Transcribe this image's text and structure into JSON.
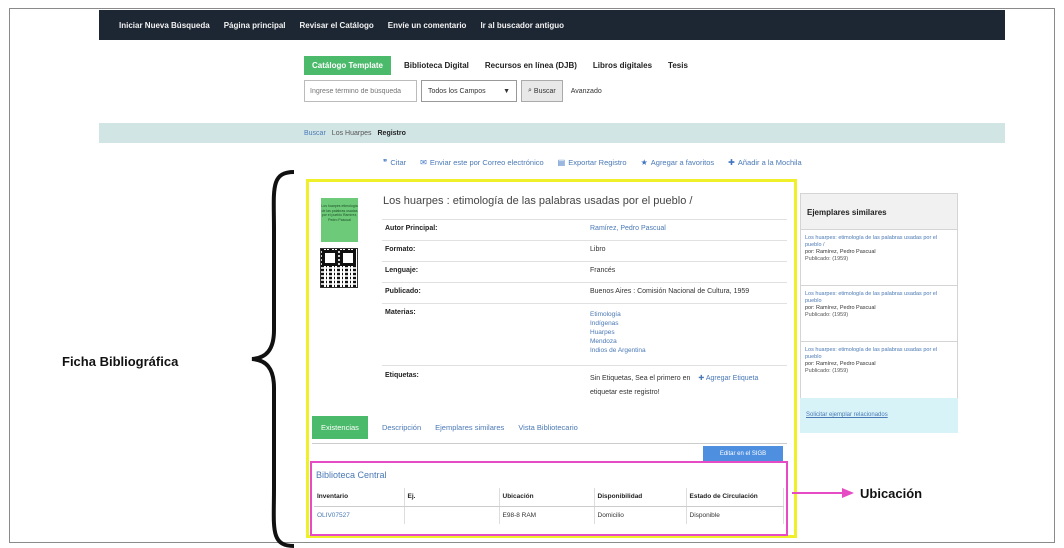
{
  "nav": {
    "items": [
      "Iniciar Nueva Búsqueda",
      "Página principal",
      "Revisar el Catálogo",
      "Envíe un comentario",
      "Ir al buscador antiguo"
    ]
  },
  "catalog_tabs": {
    "items": [
      "Catálogo Template",
      "Biblioteca Digital",
      "Recursos en línea (DJB)",
      "Libros digitales",
      "Tesis"
    ],
    "active_index": 0
  },
  "search": {
    "placeholder": "Ingrese término de búsqueda",
    "field_select": "Todos los Campos",
    "search_button": "Buscar",
    "advanced_link": "Avanzado"
  },
  "breadcrumb": {
    "items": [
      "Buscar",
      "Los Huarpes",
      "Registro"
    ]
  },
  "actions": {
    "items": [
      {
        "icon": "quote-icon",
        "label": "Citar"
      },
      {
        "icon": "mail-icon",
        "label": "Enviar este por Correo electrónico"
      },
      {
        "icon": "export-icon",
        "label": "Exportar Registro"
      },
      {
        "icon": "star-icon",
        "label": "Agregar a favoritos"
      },
      {
        "icon": "plus-icon",
        "label": "Añadir a la Mochila"
      }
    ]
  },
  "record": {
    "title": "Los huarpes : etimología de las palabras usadas por el pueblo /",
    "cover_text": "Los huarpes etimología de las palabras usadas por el pueblo Ramírez, Pedro Pascual",
    "fields": {
      "author_label": "Autor Principal:",
      "author_value": "Ramírez, Pedro Pascual",
      "format_label": "Formato:",
      "format_value": "Libro",
      "language_label": "Lenguaje:",
      "language_value": "Francés",
      "published_label": "Publicado:",
      "published_value": "Buenos Aires : Comisión Nacional de Cultura, 1959",
      "subjects_label": "Materias:",
      "subjects": [
        "Etimología",
        "Indígenas",
        "Huarpes",
        "Mendoza",
        "Indios de Argentina"
      ],
      "tags_label": "Etiquetas:",
      "tags_text": "Sin Etiquetas, Sea el primero en",
      "tags_add": "Agregar Etiqueta",
      "tags_text2": "etiquetar este registro!"
    }
  },
  "record_tabs": {
    "items": [
      "Existencias",
      "Descripción",
      "Ejemplares similares",
      "Vista Bibliotecario"
    ],
    "active_index": 0,
    "edit_button": "Editar en el SIGB"
  },
  "holdings": {
    "library": "Biblioteca Central",
    "headers": [
      "Inventario",
      "Ej.",
      "Ubicación",
      "Disponibilidad",
      "Estado de Circulación"
    ],
    "rows": [
      [
        "OLIV07527",
        "",
        "E98-8 RAM",
        "Domicilio",
        "Disponible"
      ]
    ]
  },
  "similar": {
    "heading": "Ejemplares similares",
    "items": [
      {
        "title": "Los huarpes: etimología de las palabras usadas por el pueblo /",
        "author": "por: Ramírez, Pedro Pascual",
        "published": "Publicado: (1959)"
      },
      {
        "title": "Los huarpes: etimología de las palabras usadas por el pueblo",
        "author": "por: Ramírez, Pedro Pascual",
        "published": "Publicado: (1959)"
      },
      {
        "title": "Los huarpes: etimología de las palabras usadas por el pueblo",
        "author": "por: Ramírez, Pedro Pascual",
        "published": "Publicado: (1959)"
      }
    ],
    "footer_link": "Solicitar ejemplar relacionados"
  },
  "annotations": {
    "ficha": "Ficha Bibliográfica",
    "ubicacion": "Ubicación",
    "ficha_color": "#f0f02a",
    "ubicacion_color": "#e64ac4"
  }
}
